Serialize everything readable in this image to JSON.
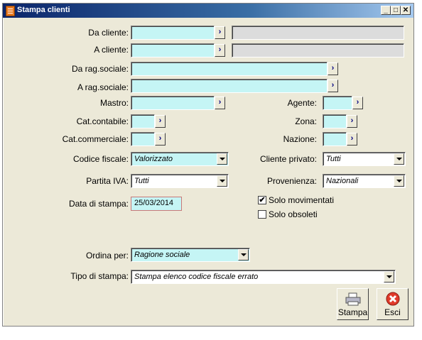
{
  "window": {
    "title": "Stampa clienti"
  },
  "titlebar_buttons": {
    "minimize": "_",
    "maximize": "□",
    "close": "✕"
  },
  "labels": {
    "da_cliente": "Da cliente:",
    "a_cliente": "A cliente:",
    "da_rag_sociale": "Da rag.sociale:",
    "a_rag_sociale": "A rag.sociale:",
    "mastro": "Mastro:",
    "agente": "Agente:",
    "cat_contabile": "Cat.contabile:",
    "zona": "Zona:",
    "cat_commerciale": "Cat.commerciale:",
    "nazione": "Nazione:",
    "codice_fiscale": "Codice fiscale:",
    "cliente_privato": "Cliente privato:",
    "partita_iva": "Partita IVA:",
    "provenienza": "Provenienza:",
    "data_stampa": "Data di stampa:",
    "ordina_per": "Ordina per:",
    "tipo_stampa": "Tipo di stampa:"
  },
  "values": {
    "codice_fiscale": "Valorizzato",
    "cliente_privato": "Tutti",
    "partita_iva": "Tutti",
    "provenienza": "Nazionali",
    "data_stampa": "25/03/2014",
    "ordina_per": "Ragione sociale",
    "tipo_stampa": "Stampa elenco codice fiscale errato"
  },
  "checkboxes": {
    "solo_movimentati": {
      "label": "Solo movimentati",
      "checked": "✔"
    },
    "solo_obsoleti": {
      "label": "Solo obsoleti",
      "checked": ""
    }
  },
  "buttons": {
    "stampa": "Stampa",
    "esci": "Esci"
  },
  "zoom_glyph": "›"
}
